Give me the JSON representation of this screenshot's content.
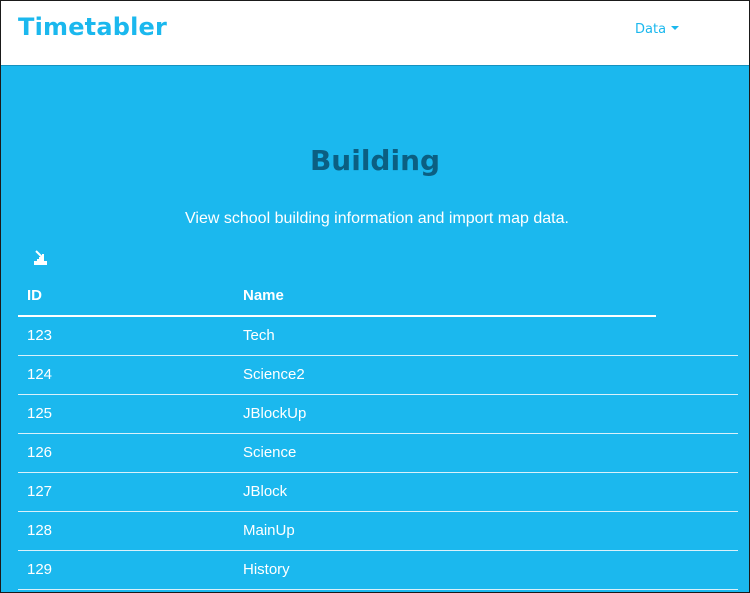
{
  "navbar": {
    "brand": "Timetabler",
    "menu": {
      "label": "Data"
    }
  },
  "page": {
    "title": "Building",
    "subtitle": "View school building information and import map data."
  },
  "toolbar": {
    "import_icon": "import-icon"
  },
  "table": {
    "columns": [
      "ID",
      "Name"
    ],
    "rows": [
      {
        "id": "123",
        "name": "Tech"
      },
      {
        "id": "124",
        "name": "Science2"
      },
      {
        "id": "125",
        "name": "JBlockUp"
      },
      {
        "id": "126",
        "name": "Science"
      },
      {
        "id": "127",
        "name": "JBlock"
      },
      {
        "id": "128",
        "name": "MainUp"
      },
      {
        "id": "129",
        "name": "History"
      }
    ]
  },
  "colors": {
    "accent": "#1bb8ee",
    "title": "#0b5f82",
    "text": "#ffffff"
  }
}
